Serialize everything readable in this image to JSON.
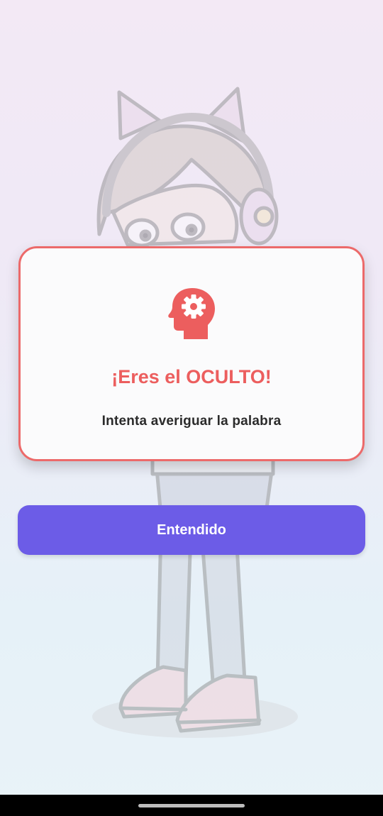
{
  "dialog": {
    "icon": "head-gear-icon",
    "title": "¡Eres el OCULTO!",
    "message": "Intenta averiguar la palabra"
  },
  "actions": {
    "confirm_label": "Entendido"
  },
  "colors": {
    "accent_red": "#ec6a6a",
    "button_purple": "#6c5ce7",
    "card_background": "#fbfbfc"
  }
}
